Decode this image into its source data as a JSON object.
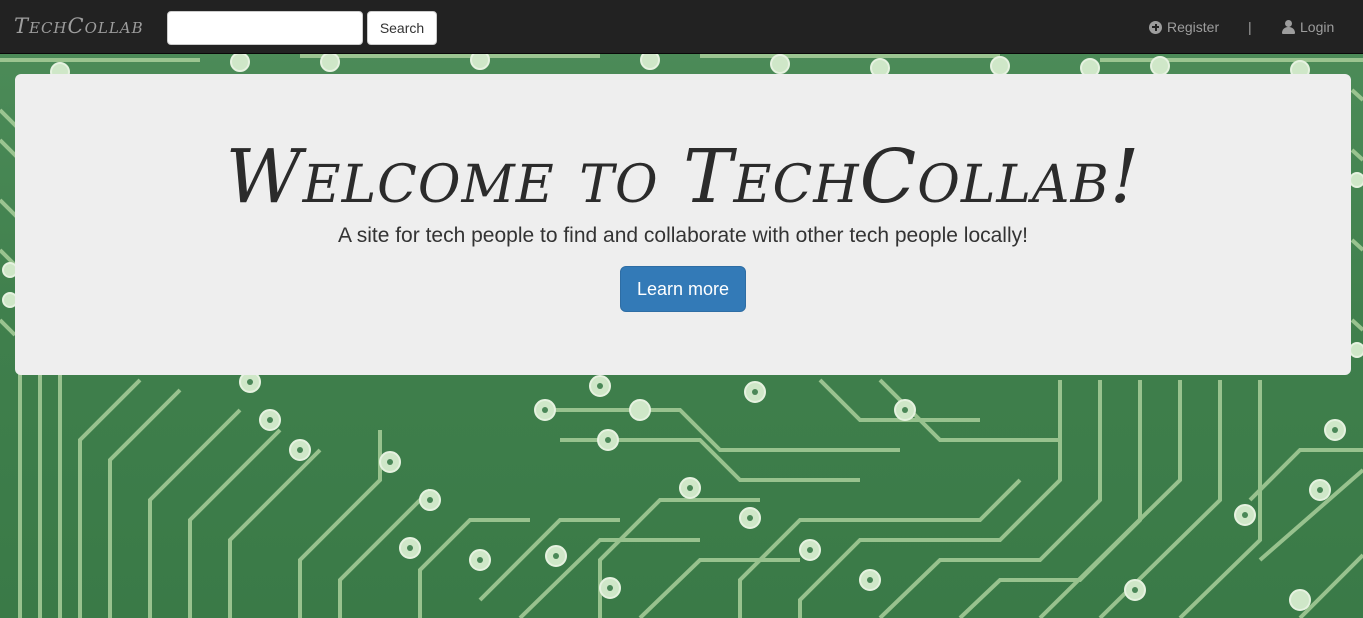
{
  "navbar": {
    "brand": "TechCollab",
    "search_placeholder": "",
    "search_button": "Search",
    "register": "Register",
    "separator": "|",
    "login": "Login",
    "register_icon": "plus-circle-icon",
    "login_icon": "user-icon"
  },
  "jumbotron": {
    "title": "Welcome to TechCollab!",
    "subtitle": "A site for tech people to find and collaborate with other tech people locally!",
    "button": "Learn more"
  },
  "colors": {
    "navbar_bg": "#222222",
    "navbar_text": "#9d9d9d",
    "jumbotron_bg": "#eeeeee",
    "primary_button": "#337ab7",
    "background_green": "#4e8d5a"
  }
}
